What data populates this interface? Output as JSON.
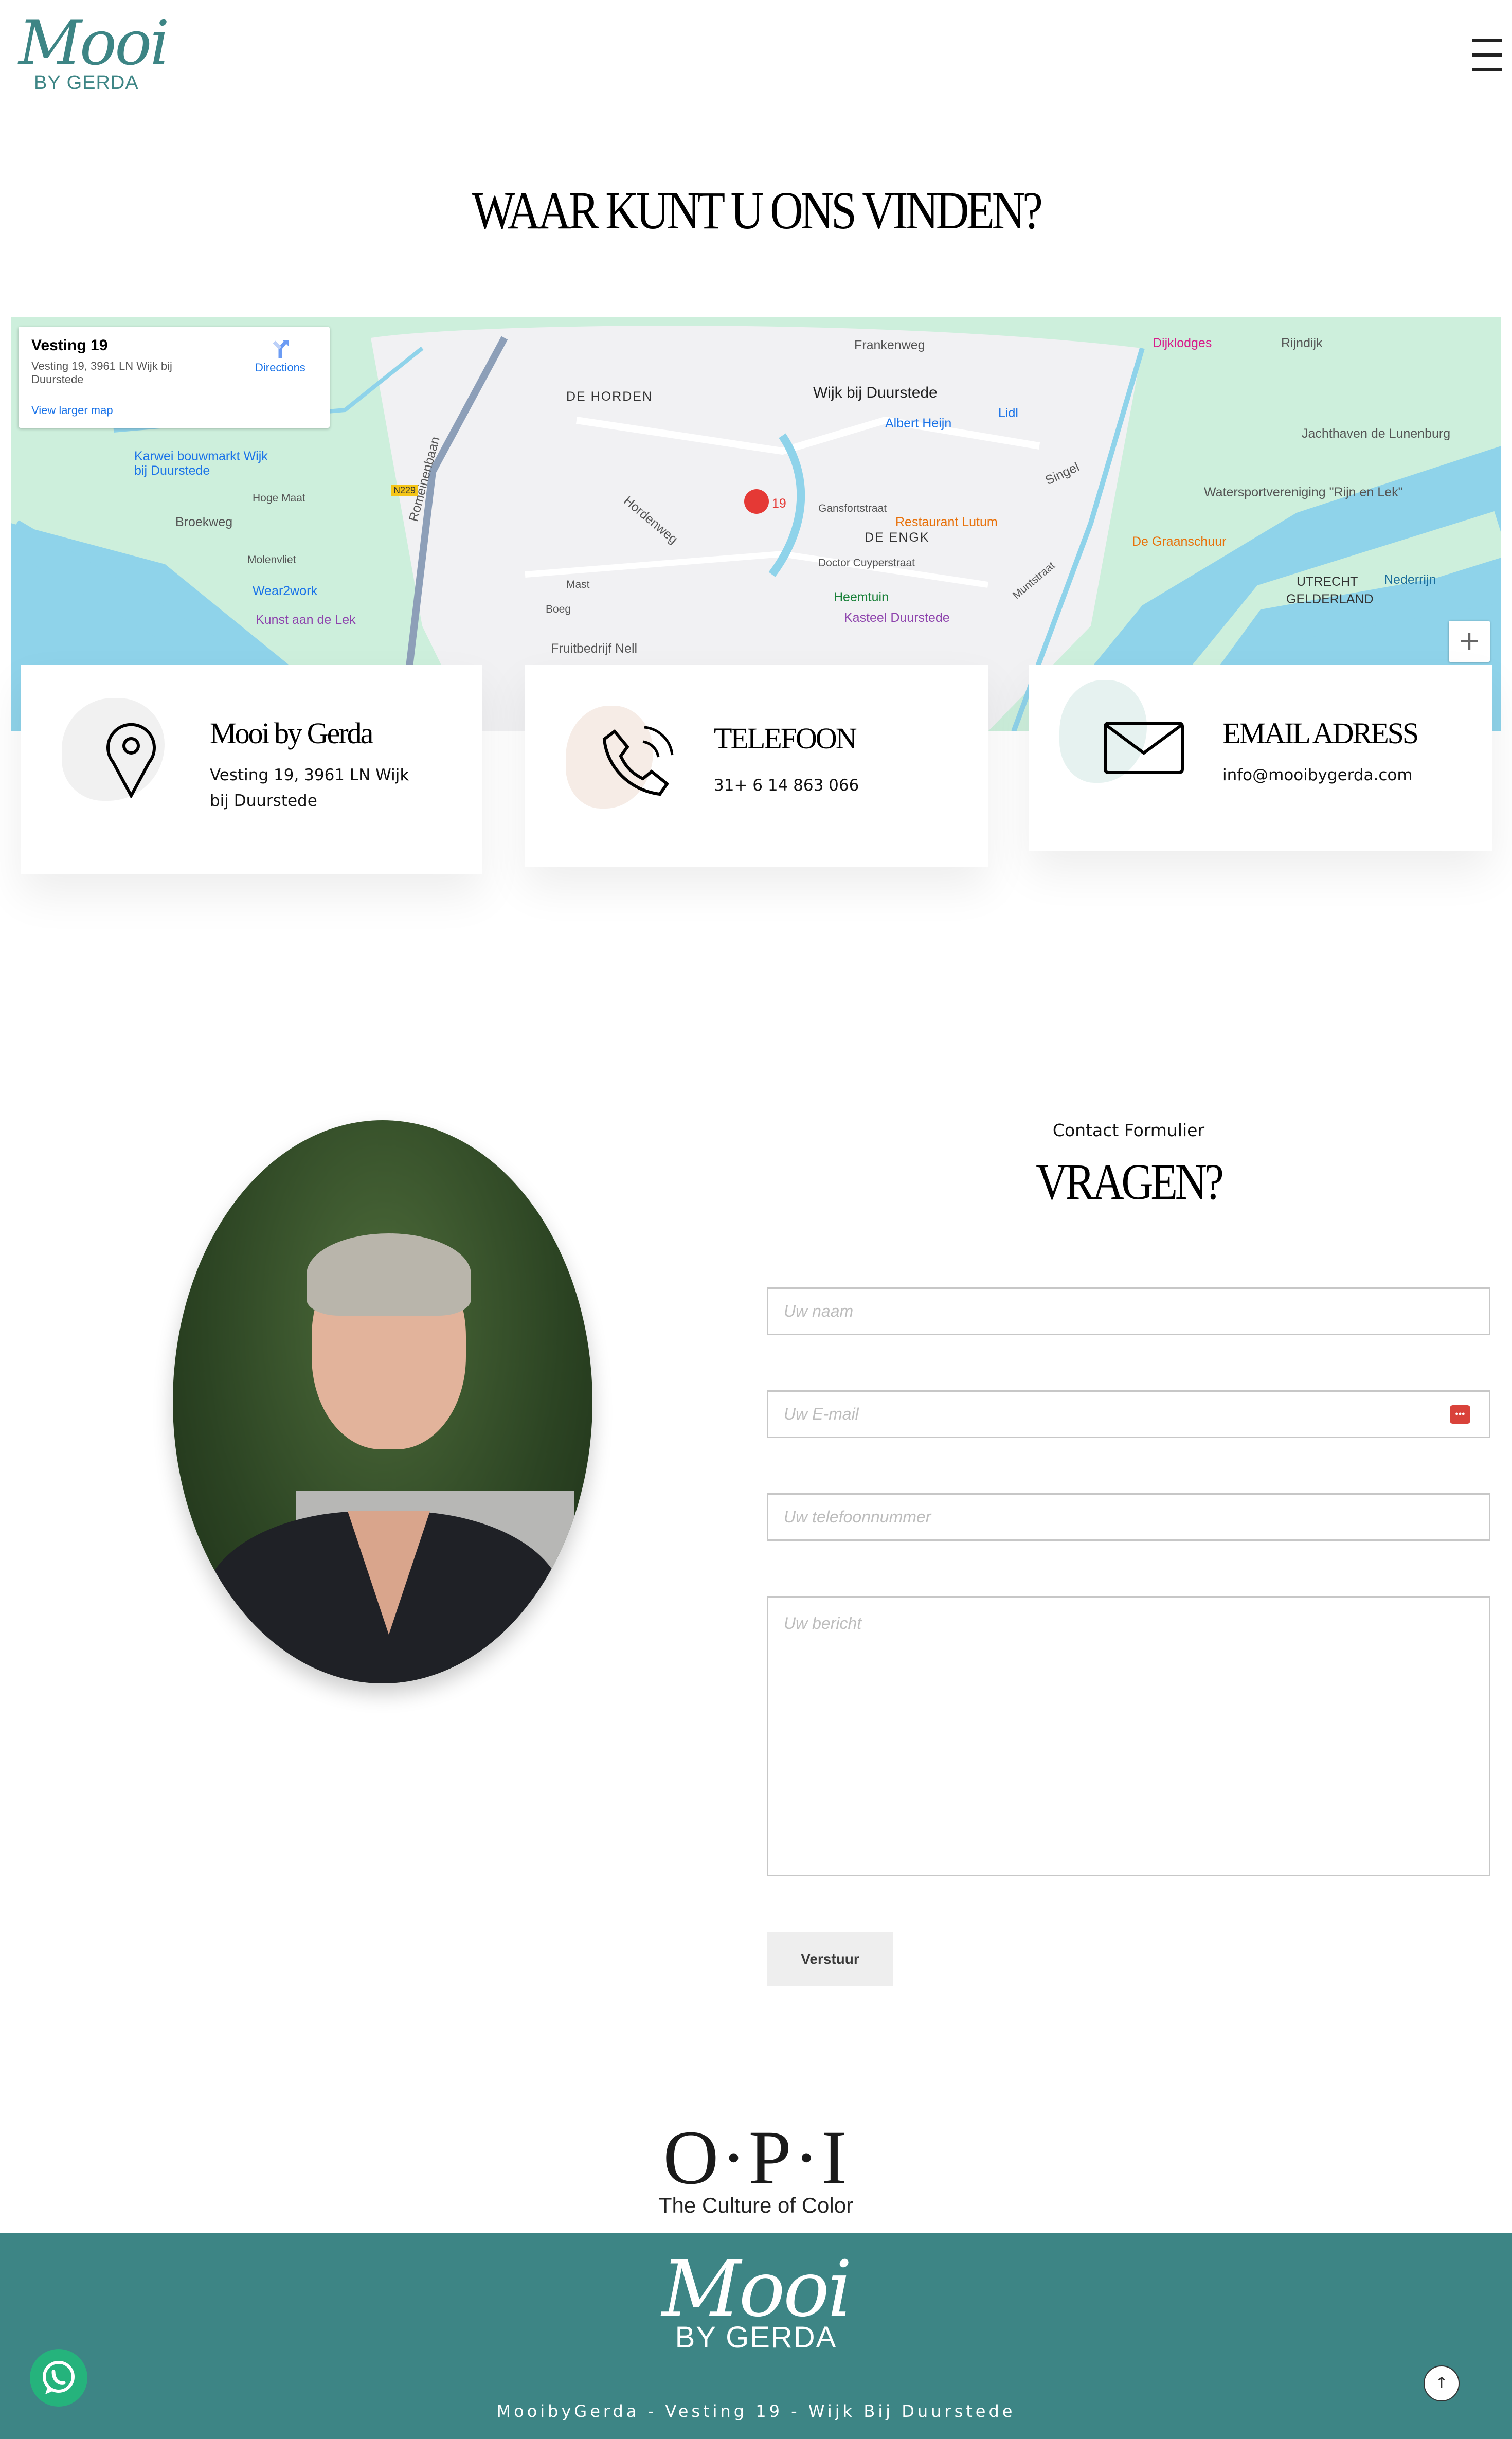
{
  "header": {
    "logo_main": "Mooi",
    "logo_sub": "BY GERDA",
    "menu_icon": "hamburger-icon"
  },
  "location": {
    "title": "WAAR KUNT U ONS VINDEN?"
  },
  "map": {
    "info": {
      "title": "Vesting 19",
      "address": "Vesting 19, 3961 LN Wijk bij Duurstede",
      "directions": "Directions",
      "larger": "View larger map"
    },
    "labels": [
      "DE HORDEN",
      "Wijk bij Duurstede",
      "Frankenweg",
      "Albert Heijn",
      "Lidl",
      "Dijklodges",
      "Rijndijk",
      "Jachthaven de Lunenburg",
      "Watersportvereniging \"Rijn en Lek\"",
      "De Graanschuur",
      "Restaurant Lutum",
      "Gansfortstraat",
      "DE ENGK",
      "Doctor Cuyperstraat",
      "Heemtuin",
      "Kasteel Duurstede",
      "Karwei bouwmarkt Wijk bij Duurstede",
      "Broekweg",
      "Hoge Maat",
      "Molenvliet",
      "Wear2work",
      "Kunst aan de Lek",
      "Fruitbedrijf Nell",
      "Mast",
      "Boeg",
      "Romeinenbaan",
      "Hordenweg",
      "UTRECHT",
      "GELDERLAND",
      "Nederrijn",
      "Singel",
      "Muntstraat",
      "19",
      "N229"
    ],
    "zoom_in": "+",
    "colors": {
      "land": "#cdefdc",
      "urban": "#f1f1f3",
      "water": "#8fd3ea",
      "road": "#ffffff",
      "pin": "#e53935"
    }
  },
  "cards": [
    {
      "title": "Mooi by Gerda",
      "text": "Vesting 19, 3961 LN Wijk bij Duurstede",
      "icon": "map-pin-icon"
    },
    {
      "title": "TELEFOON",
      "text": "31+ 6 14 863 066",
      "icon": "phone-icon"
    },
    {
      "title": "EMAIL ADRESS",
      "text": "info@mooibygerda.com",
      "icon": "envelope-icon"
    }
  ],
  "contact": {
    "kicker": "Contact Formulier",
    "title": "VRAGEN?",
    "fields": {
      "name": "Uw naam",
      "email": "Uw E-mail",
      "phone": "Uw telefoonnummer",
      "message": "Uw bericht"
    },
    "submit": "Verstuur"
  },
  "brand": {
    "logo": "O·P·I",
    "tagline": "The Culture of Color"
  },
  "footer": {
    "logo_main": "Mooi",
    "logo_sub": "BY GERDA",
    "address": "MooibyGerda - Vesting 19 - Wijk Bij Duurstede",
    "bg": "#3d8585"
  },
  "floating": {
    "whatsapp": "whatsapp-icon",
    "scroll_top": "↑"
  }
}
